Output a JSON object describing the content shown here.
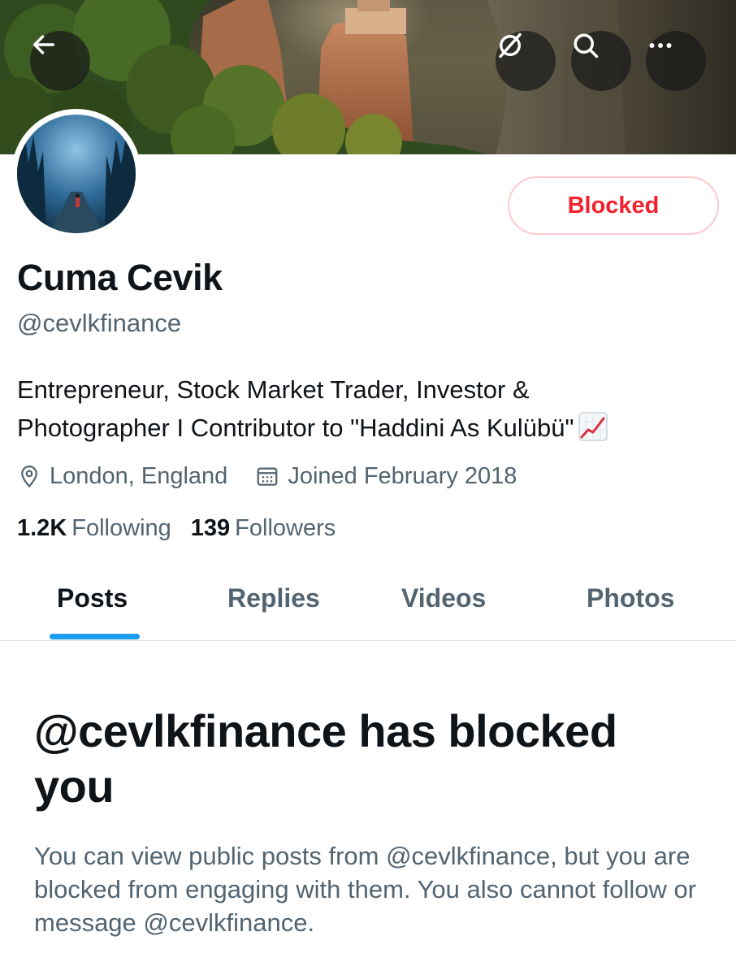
{
  "header": {
    "back_icon": "arrow-left-icon",
    "grok_icon": "grok-icon",
    "search_icon": "search-icon",
    "more_icon": "more-horizontal-icon"
  },
  "profile": {
    "name": "Cuma Cevik",
    "handle": "@cevlkfinance",
    "bio_line1": "Entrepreneur, Stock Market Trader, Investor &",
    "bio_line2": "Photographer I Contributor to \"Haddini As Kulübü\"",
    "bio_emoji": "chart-increasing-icon",
    "location": "London, England",
    "joined": "Joined February 2018",
    "following_count": "1.2K",
    "following_label": "Following",
    "followers_count": "139",
    "followers_label": "Followers",
    "action_button": "Blocked"
  },
  "tabs": [
    {
      "label": "Posts",
      "active": true
    },
    {
      "label": "Replies",
      "active": false
    },
    {
      "label": "Videos",
      "active": false
    },
    {
      "label": "Photos",
      "active": false
    }
  ],
  "blocked_notice": {
    "title": "@cevlkfinance has blocked you",
    "description": "You can view public posts from @cevlkfinance, but you are blocked from engaging with them. You also cannot follow or message @cevlkfinance."
  },
  "colors": {
    "accent": "#1d9bf0",
    "blocked_red": "#f4212e",
    "secondary_text": "#536471"
  }
}
